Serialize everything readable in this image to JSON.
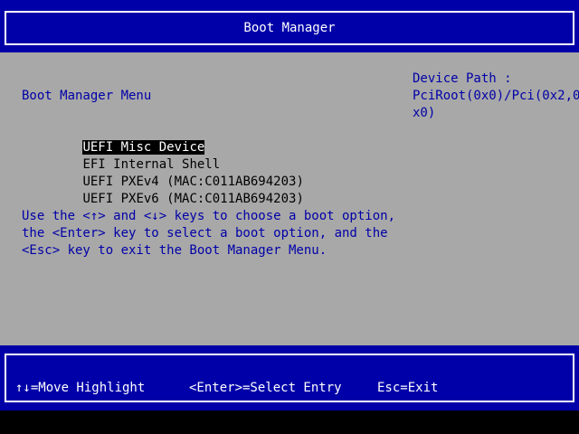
{
  "header": {
    "title": "Boot Manager"
  },
  "menu": {
    "heading": "Boot Manager Menu",
    "items": [
      {
        "label": "UEFI Misc Device",
        "selected": true
      },
      {
        "label": "EFI Internal Shell",
        "selected": false
      },
      {
        "label": "UEFI PXEv4 (MAC:C011AB694203)",
        "selected": false
      },
      {
        "label": "UEFI PXEv6 (MAC:C011AB694203)",
        "selected": false
      }
    ]
  },
  "help": {
    "lines": [
      "Use the <↑> and <↓> keys to choose a boot option,",
      "the <Enter> key to select a boot option, and the",
      "<Esc> key to exit the Boot Manager Menu."
    ]
  },
  "device_path": {
    "lines": [
      "Device Path :",
      "PciRoot(0x0)/Pci(0x2,0",
      "x0)"
    ]
  },
  "footer": {
    "move_hint": "↑↓=Move Highlight",
    "enter_hint": "<Enter>=Select Entry",
    "exit_hint": "Esc=Exit"
  },
  "colors": {
    "title_background": "#0000a8",
    "panel_background": "#a8a8a8",
    "text_blue": "#0000a8",
    "highlight_background": "#000000",
    "highlight_text": "#ffffff"
  }
}
